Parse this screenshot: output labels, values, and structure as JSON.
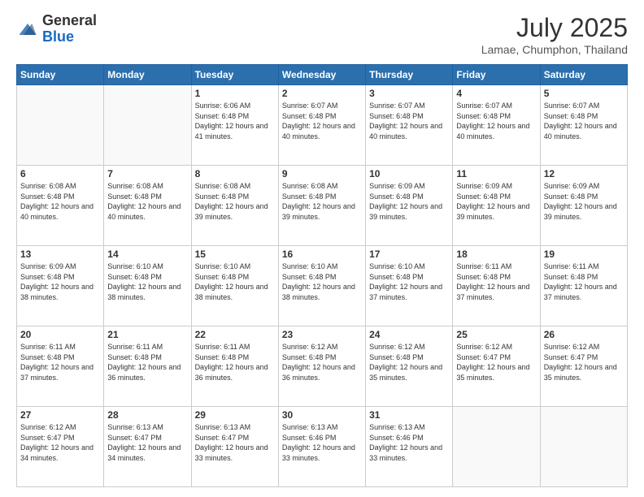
{
  "header": {
    "logo_general": "General",
    "logo_blue": "Blue",
    "month_year": "July 2025",
    "location": "Lamae, Chumphon, Thailand"
  },
  "days_of_week": [
    "Sunday",
    "Monday",
    "Tuesday",
    "Wednesday",
    "Thursday",
    "Friday",
    "Saturday"
  ],
  "weeks": [
    [
      {
        "day": "",
        "sunrise": "",
        "sunset": "",
        "daylight": ""
      },
      {
        "day": "",
        "sunrise": "",
        "sunset": "",
        "daylight": ""
      },
      {
        "day": "1",
        "sunrise": "Sunrise: 6:06 AM",
        "sunset": "Sunset: 6:48 PM",
        "daylight": "Daylight: 12 hours and 41 minutes."
      },
      {
        "day": "2",
        "sunrise": "Sunrise: 6:07 AM",
        "sunset": "Sunset: 6:48 PM",
        "daylight": "Daylight: 12 hours and 40 minutes."
      },
      {
        "day": "3",
        "sunrise": "Sunrise: 6:07 AM",
        "sunset": "Sunset: 6:48 PM",
        "daylight": "Daylight: 12 hours and 40 minutes."
      },
      {
        "day": "4",
        "sunrise": "Sunrise: 6:07 AM",
        "sunset": "Sunset: 6:48 PM",
        "daylight": "Daylight: 12 hours and 40 minutes."
      },
      {
        "day": "5",
        "sunrise": "Sunrise: 6:07 AM",
        "sunset": "Sunset: 6:48 PM",
        "daylight": "Daylight: 12 hours and 40 minutes."
      }
    ],
    [
      {
        "day": "6",
        "sunrise": "Sunrise: 6:08 AM",
        "sunset": "Sunset: 6:48 PM",
        "daylight": "Daylight: 12 hours and 40 minutes."
      },
      {
        "day": "7",
        "sunrise": "Sunrise: 6:08 AM",
        "sunset": "Sunset: 6:48 PM",
        "daylight": "Daylight: 12 hours and 40 minutes."
      },
      {
        "day": "8",
        "sunrise": "Sunrise: 6:08 AM",
        "sunset": "Sunset: 6:48 PM",
        "daylight": "Daylight: 12 hours and 39 minutes."
      },
      {
        "day": "9",
        "sunrise": "Sunrise: 6:08 AM",
        "sunset": "Sunset: 6:48 PM",
        "daylight": "Daylight: 12 hours and 39 minutes."
      },
      {
        "day": "10",
        "sunrise": "Sunrise: 6:09 AM",
        "sunset": "Sunset: 6:48 PM",
        "daylight": "Daylight: 12 hours and 39 minutes."
      },
      {
        "day": "11",
        "sunrise": "Sunrise: 6:09 AM",
        "sunset": "Sunset: 6:48 PM",
        "daylight": "Daylight: 12 hours and 39 minutes."
      },
      {
        "day": "12",
        "sunrise": "Sunrise: 6:09 AM",
        "sunset": "Sunset: 6:48 PM",
        "daylight": "Daylight: 12 hours and 39 minutes."
      }
    ],
    [
      {
        "day": "13",
        "sunrise": "Sunrise: 6:09 AM",
        "sunset": "Sunset: 6:48 PM",
        "daylight": "Daylight: 12 hours and 38 minutes."
      },
      {
        "day": "14",
        "sunrise": "Sunrise: 6:10 AM",
        "sunset": "Sunset: 6:48 PM",
        "daylight": "Daylight: 12 hours and 38 minutes."
      },
      {
        "day": "15",
        "sunrise": "Sunrise: 6:10 AM",
        "sunset": "Sunset: 6:48 PM",
        "daylight": "Daylight: 12 hours and 38 minutes."
      },
      {
        "day": "16",
        "sunrise": "Sunrise: 6:10 AM",
        "sunset": "Sunset: 6:48 PM",
        "daylight": "Daylight: 12 hours and 38 minutes."
      },
      {
        "day": "17",
        "sunrise": "Sunrise: 6:10 AM",
        "sunset": "Sunset: 6:48 PM",
        "daylight": "Daylight: 12 hours and 37 minutes."
      },
      {
        "day": "18",
        "sunrise": "Sunrise: 6:11 AM",
        "sunset": "Sunset: 6:48 PM",
        "daylight": "Daylight: 12 hours and 37 minutes."
      },
      {
        "day": "19",
        "sunrise": "Sunrise: 6:11 AM",
        "sunset": "Sunset: 6:48 PM",
        "daylight": "Daylight: 12 hours and 37 minutes."
      }
    ],
    [
      {
        "day": "20",
        "sunrise": "Sunrise: 6:11 AM",
        "sunset": "Sunset: 6:48 PM",
        "daylight": "Daylight: 12 hours and 37 minutes."
      },
      {
        "day": "21",
        "sunrise": "Sunrise: 6:11 AM",
        "sunset": "Sunset: 6:48 PM",
        "daylight": "Daylight: 12 hours and 36 minutes."
      },
      {
        "day": "22",
        "sunrise": "Sunrise: 6:11 AM",
        "sunset": "Sunset: 6:48 PM",
        "daylight": "Daylight: 12 hours and 36 minutes."
      },
      {
        "day": "23",
        "sunrise": "Sunrise: 6:12 AM",
        "sunset": "Sunset: 6:48 PM",
        "daylight": "Daylight: 12 hours and 36 minutes."
      },
      {
        "day": "24",
        "sunrise": "Sunrise: 6:12 AM",
        "sunset": "Sunset: 6:48 PM",
        "daylight": "Daylight: 12 hours and 35 minutes."
      },
      {
        "day": "25",
        "sunrise": "Sunrise: 6:12 AM",
        "sunset": "Sunset: 6:47 PM",
        "daylight": "Daylight: 12 hours and 35 minutes."
      },
      {
        "day": "26",
        "sunrise": "Sunrise: 6:12 AM",
        "sunset": "Sunset: 6:47 PM",
        "daylight": "Daylight: 12 hours and 35 minutes."
      }
    ],
    [
      {
        "day": "27",
        "sunrise": "Sunrise: 6:12 AM",
        "sunset": "Sunset: 6:47 PM",
        "daylight": "Daylight: 12 hours and 34 minutes."
      },
      {
        "day": "28",
        "sunrise": "Sunrise: 6:13 AM",
        "sunset": "Sunset: 6:47 PM",
        "daylight": "Daylight: 12 hours and 34 minutes."
      },
      {
        "day": "29",
        "sunrise": "Sunrise: 6:13 AM",
        "sunset": "Sunset: 6:47 PM",
        "daylight": "Daylight: 12 hours and 33 minutes."
      },
      {
        "day": "30",
        "sunrise": "Sunrise: 6:13 AM",
        "sunset": "Sunset: 6:46 PM",
        "daylight": "Daylight: 12 hours and 33 minutes."
      },
      {
        "day": "31",
        "sunrise": "Sunrise: 6:13 AM",
        "sunset": "Sunset: 6:46 PM",
        "daylight": "Daylight: 12 hours and 33 minutes."
      },
      {
        "day": "",
        "sunrise": "",
        "sunset": "",
        "daylight": ""
      },
      {
        "day": "",
        "sunrise": "",
        "sunset": "",
        "daylight": ""
      }
    ]
  ]
}
